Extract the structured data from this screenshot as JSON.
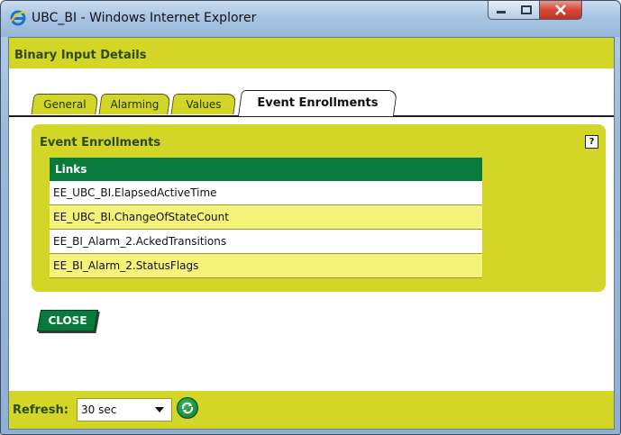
{
  "window": {
    "title": "UBC_BI - Windows Internet Explorer",
    "minimize_glyph": "–",
    "maximize_glyph": "□",
    "close_glyph": "X"
  },
  "page": {
    "header_title": "Binary Input Details"
  },
  "tabs": [
    {
      "label": "General",
      "active": false
    },
    {
      "label": "Alarming",
      "active": false
    },
    {
      "label": "Values",
      "active": false
    },
    {
      "label": "Event Enrollments",
      "active": true
    }
  ],
  "panel": {
    "title": "Event Enrollments",
    "help_glyph": "?",
    "table": {
      "header": "Links",
      "rows": [
        "EE_UBC_BI.ElapsedActiveTime",
        "EE_UBC_BI.ChangeOfStateCount",
        "EE_BI_Alarm_2.AckedTransitions",
        "EE_BI_Alarm_2.StatusFlags"
      ]
    }
  },
  "close_button": {
    "label": "CLOSE"
  },
  "footer": {
    "refresh_label": "Refresh:",
    "refresh_value": "30 sec"
  },
  "colors": {
    "bar_yellow": "#d3d627",
    "row_yellow": "#f4f279",
    "green": "#087a3b"
  },
  "icons": {
    "browser": "ie-icon",
    "help": "help-icon",
    "refresh": "refresh-icon"
  }
}
